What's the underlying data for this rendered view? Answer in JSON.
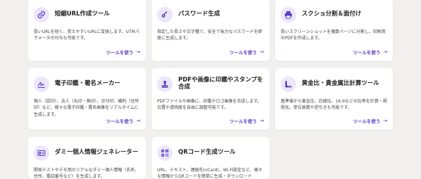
{
  "accent": "#5b3fc4",
  "icon_bg": "#ece6fa",
  "tools": [
    {
      "icon": "link-icon",
      "title": "短縮URL作成ツール",
      "desc": "長いURLを短く、覚えやすいURLに変換します。UTMパラメータの付与も可能です。",
      "link": "ツールを使う"
    },
    {
      "icon": "key-icon",
      "title": "パスワード生成",
      "desc": "指定した長さや文字種で、安全で強力なパスワードを即座に生成します。",
      "link": "ツールを使う"
    },
    {
      "icon": "print-icon",
      "title": "スクショ分割＆面付け",
      "desc": "長いスクリーンショットを複数ページに分割し、印刷用のPDFを作成します。",
      "link": "ツールを使う"
    },
    {
      "icon": "signature-icon",
      "title": "電子印鑑・署名メーカー",
      "desc": "個人（認印）、法人（丸印・角印）、日付印、横判（住所印）など、様々な電子印鑑・署名画像をリアルタイムに生成します。",
      "link": "ツールを使う"
    },
    {
      "icon": "stamp-icon",
      "title": "PDFや画像に印鑑やスタンプを合成",
      "desc": "PDFファイルや画像に、印鑑やロゴ画像を合成します。位置や透明度を自由に調整可能です。",
      "link": "ツールを使う"
    },
    {
      "icon": "ruler-icon",
      "title": "黄金比・貴金属比計算ツール",
      "desc": "基準値から黄金比、白銀比、16:9などの比率を計算・視覚化。単位換算や逆引きも可能です。",
      "link": "ツールを使う"
    },
    {
      "icon": "id-card-icon",
      "title": "ダミー個人情報ジェネレーター",
      "desc": "開発テストやデモ用のリアルなダミー個人情報（氏名、住所、電話番号など）を生成します。",
      "link": ""
    },
    {
      "icon": "qrcode-icon",
      "title": "QRコード生成ツール",
      "desc": "URL、テキスト、連絡先(vCard)、Wi-Fi設定など、様々な情報からQRコードを簡単に生成・ダウンロード",
      "link": ""
    }
  ]
}
